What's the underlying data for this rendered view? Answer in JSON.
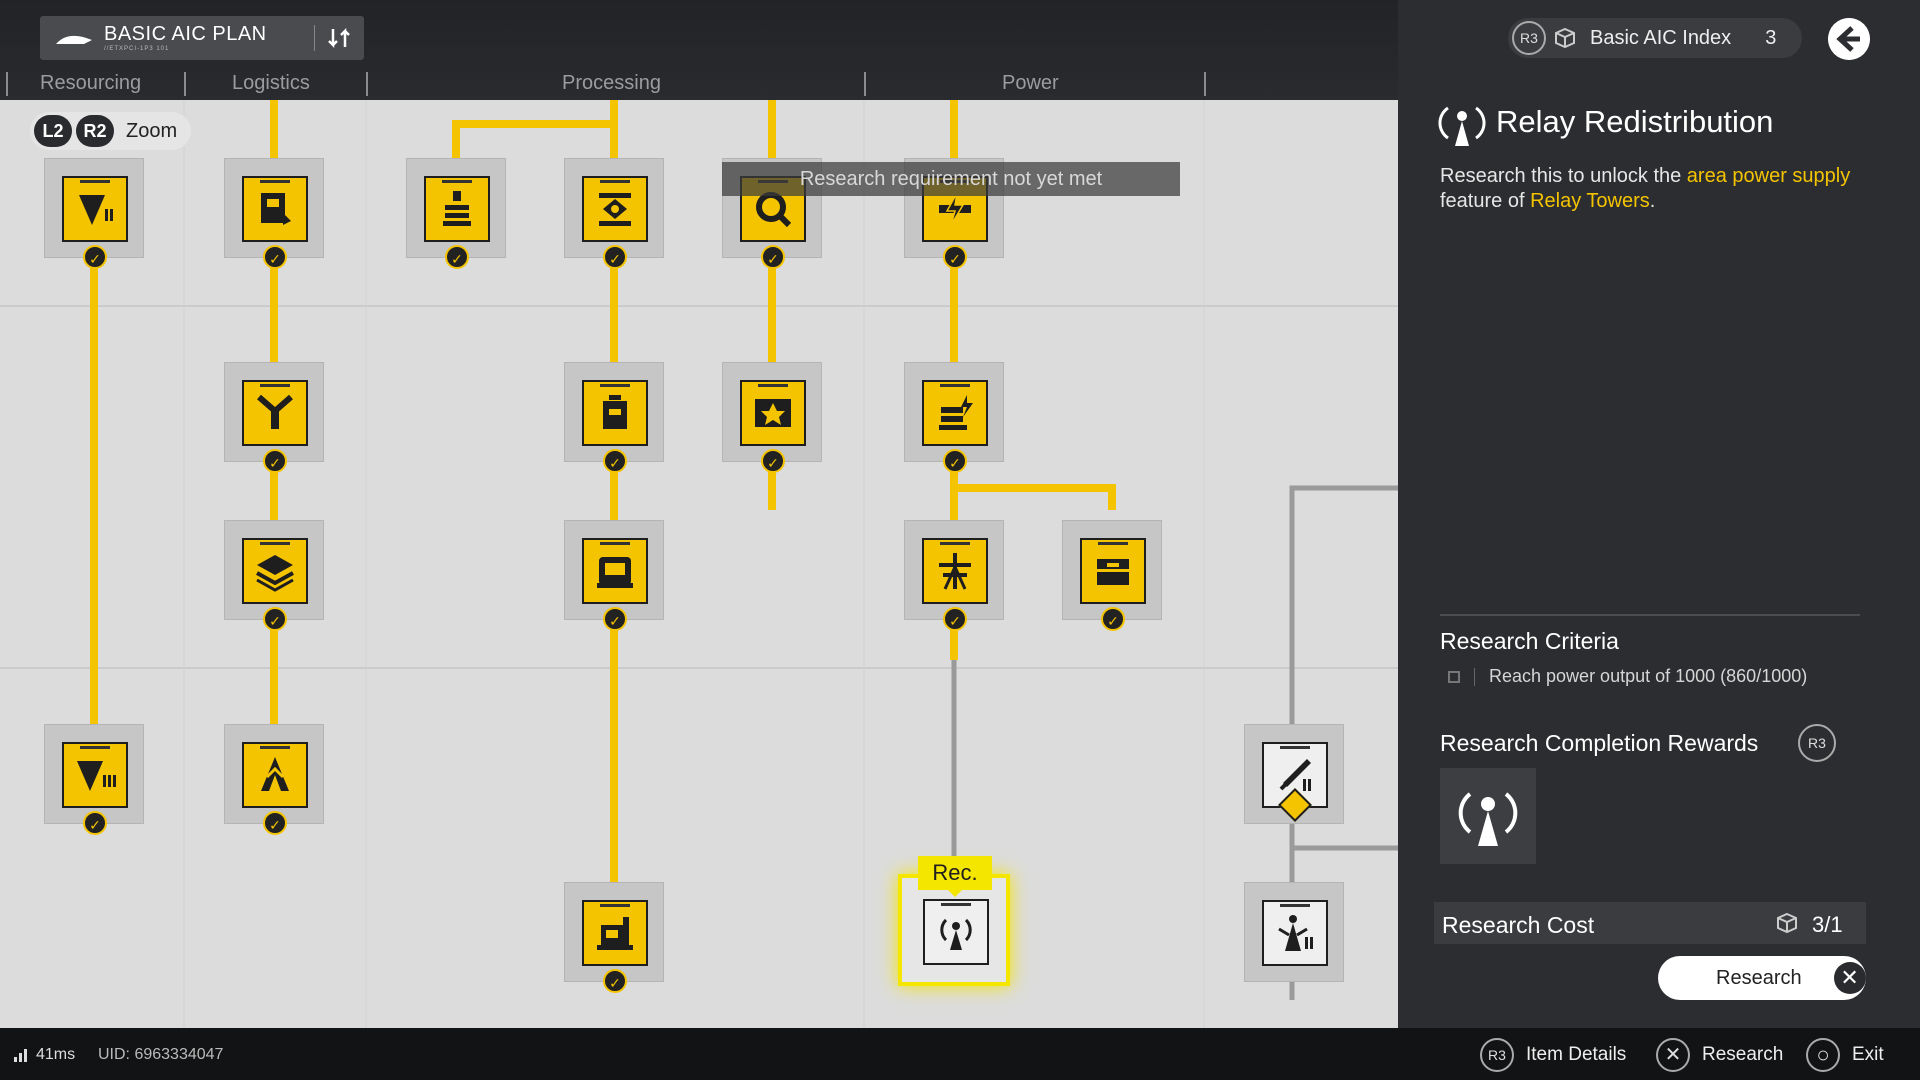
{
  "plan": {
    "title": "BASIC AIC PLAN",
    "subtitle": "//ETXPCI-1P3 101"
  },
  "categories": [
    "Resourcing",
    "Logistics",
    "Processing",
    "Power"
  ],
  "zoom_hint": {
    "btn_l": "L2",
    "btn_r": "R2",
    "label": "Zoom"
  },
  "requirement_banner": "Research requirement not yet met",
  "rec_tag": "Rec.",
  "index": {
    "button": "R3",
    "label": "Basic AIC Index",
    "value": "3"
  },
  "detail": {
    "title": "Relay Redistribution",
    "desc_1": "Research this to unlock the ",
    "desc_hl_1": "area power supply",
    "desc_2": " feature of ",
    "desc_hl_2": "Relay Towers",
    "desc_3": "."
  },
  "criteria": {
    "title": "Research Criteria",
    "item": "Reach power output of 1000 (860/1000)"
  },
  "rewards": {
    "title": "Research Completion Rewards",
    "button": "R3"
  },
  "cost": {
    "label": "Research Cost",
    "value": "3/1"
  },
  "research_button": {
    "label": "Research",
    "glyph": "✕"
  },
  "footer": {
    "ping": "41ms",
    "uid": "UID: 6963334047",
    "actions": [
      {
        "glyph": "R3",
        "label": "Item Details"
      },
      {
        "glyph": "✕",
        "label": "Research"
      },
      {
        "glyph": "○",
        "label": "Exit"
      }
    ]
  },
  "colors": {
    "accent": "#f5c400",
    "highlight": "#f5e600",
    "panel": "#2c2d30",
    "tree_bg": "#dcdcdc"
  },
  "nodes": [
    {
      "id": "n1",
      "icon": "drill-mark-2-icon",
      "status": "completed"
    },
    {
      "id": "n2",
      "icon": "storage-icon",
      "status": "completed"
    },
    {
      "id": "n3",
      "icon": "stack-icon",
      "status": "completed"
    },
    {
      "id": "n4",
      "icon": "refiner-icon",
      "status": "completed"
    },
    {
      "id": "n5",
      "icon": "gear-search-icon",
      "status": "completed"
    },
    {
      "id": "n6",
      "icon": "power-bolt-icon",
      "status": "completed"
    },
    {
      "id": "n7",
      "icon": "splitter-icon",
      "status": "completed"
    },
    {
      "id": "n8",
      "icon": "canister-icon",
      "status": "completed"
    },
    {
      "id": "n9",
      "icon": "assembler-icon",
      "status": "completed"
    },
    {
      "id": "n10",
      "icon": "battery-icon",
      "status": "completed"
    },
    {
      "id": "n11",
      "icon": "layers-icon",
      "status": "completed"
    },
    {
      "id": "n12",
      "icon": "furnace-icon",
      "status": "completed"
    },
    {
      "id": "n13",
      "icon": "pylon-icon",
      "status": "completed"
    },
    {
      "id": "n14",
      "icon": "crate-icon",
      "status": "completed"
    },
    {
      "id": "n15",
      "icon": "drill-mark-3-icon",
      "status": "completed"
    },
    {
      "id": "n16",
      "icon": "tower-icon",
      "status": "completed"
    },
    {
      "id": "n17",
      "icon": "lathe-icon",
      "status": "completed"
    },
    {
      "id": "n18",
      "icon": "relay-tower-icon",
      "status": "recommended"
    },
    {
      "id": "n19",
      "icon": "rocket-icon",
      "status": "locked"
    },
    {
      "id": "n20",
      "icon": "relay-tower-2-icon",
      "status": "locked"
    }
  ]
}
